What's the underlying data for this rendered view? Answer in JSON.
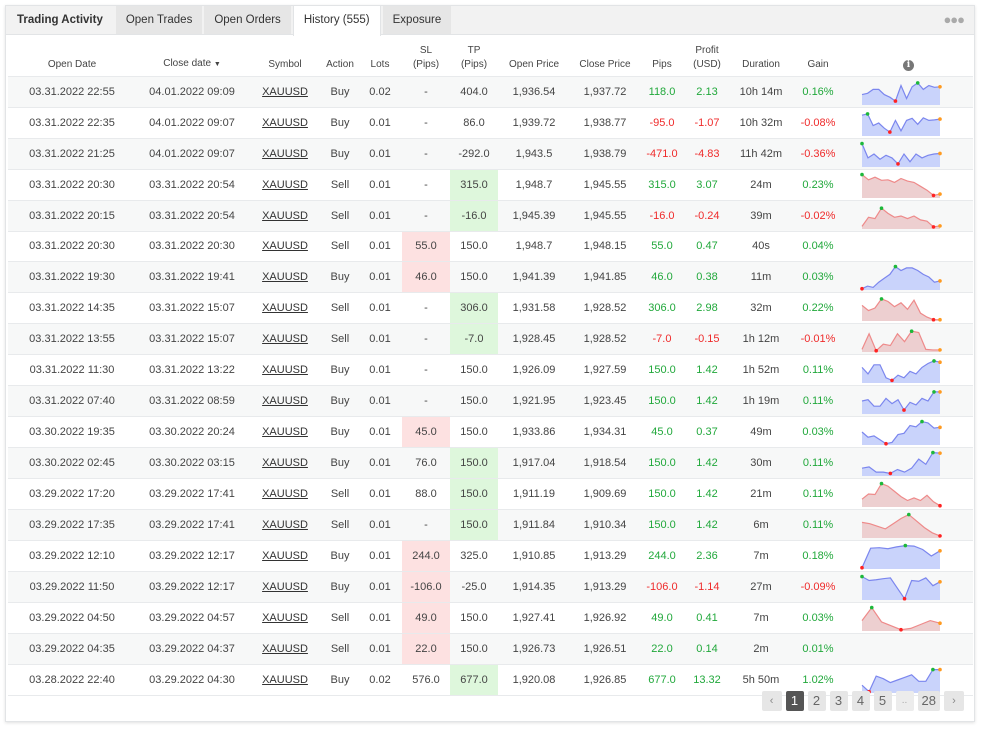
{
  "tabs": [
    {
      "label": "Trading Activity",
      "kind": "title"
    },
    {
      "label": "Open Trades"
    },
    {
      "label": "Open Orders"
    },
    {
      "label": "History (555)",
      "active": true
    },
    {
      "label": "Exposure"
    }
  ],
  "more_icon": "ellipsis-icon",
  "columns": {
    "open_date": "Open Date",
    "close_date": "Close date",
    "symbol": "Symbol",
    "action": "Action",
    "lots": "Lots",
    "sl_1": "SL",
    "sl_2": "(Pips)",
    "tp_1": "TP",
    "tp_2": "(Pips)",
    "open_price": "Open Price",
    "close_price": "Close Price",
    "pips": "Pips",
    "profit_1": "Profit",
    "profit_2": "(USD)",
    "duration": "Duration",
    "gain": "Gain",
    "info": "i"
  },
  "colors": {
    "positive": "#21a83b",
    "negative": "#ef2b2b",
    "buy_chart": "#7b86ee",
    "sell_chart": "#ee8a8a",
    "sl_highlight": "#fde1e1",
    "tp_highlight": "#def7dc"
  },
  "rows": [
    {
      "open": "03.31.2022 22:55",
      "close": "04.01.2022 09:09",
      "symbol": "XAUUSD",
      "action": "Buy",
      "lots": "0.02",
      "sl": "-",
      "tp": "404.0",
      "op": "1,936.54",
      "cp": "1,937.72",
      "pips": "118.0",
      "profit": "2.13",
      "duration": "10h 14m",
      "gain": "0.16%",
      "sign": "pos",
      "sl_hl": false,
      "tp_hl": false,
      "spark": [
        40,
        45,
        60,
        60,
        40,
        30,
        15,
        75,
        25,
        70,
        85,
        60,
        75,
        68,
        70
      ]
    },
    {
      "open": "03.31.2022 22:35",
      "close": "04.01.2022 09:07",
      "symbol": "XAUUSD",
      "action": "Buy",
      "lots": "0.01",
      "sl": "-",
      "tp": "86.0",
      "op": "1,939.72",
      "cp": "1,938.77",
      "pips": "-95.0",
      "profit": "-1.07",
      "duration": "10h 32m",
      "gain": "-0.08%",
      "sign": "neg",
      "sl_hl": false,
      "tp_hl": false,
      "spark": [
        80,
        85,
        40,
        50,
        30,
        15,
        60,
        20,
        60,
        68,
        45,
        70,
        60,
        62,
        65
      ]
    },
    {
      "open": "03.31.2022 21:25",
      "close": "04.01.2022 09:07",
      "symbol": "XAUUSD",
      "action": "Buy",
      "lots": "0.01",
      "sl": "-",
      "tp": "-292.0",
      "op": "1,943.5",
      "cp": "1,938.79",
      "pips": "-471.0",
      "profit": "-4.83",
      "duration": "11h 42m",
      "gain": "-0.36%",
      "sign": "neg",
      "sl_hl": false,
      "tp_hl": false,
      "spark": [
        90,
        35,
        50,
        30,
        45,
        35,
        12,
        50,
        20,
        50,
        35,
        45,
        50,
        52
      ]
    },
    {
      "open": "03.31.2022 20:30",
      "close": "03.31.2022 20:54",
      "symbol": "XAUUSD",
      "action": "Sell",
      "lots": "0.01",
      "sl": "-",
      "tp": "315.0",
      "op": "1,948.7",
      "cp": "1,945.55",
      "pips": "315.0",
      "profit": "3.07",
      "duration": "24m",
      "gain": "0.23%",
      "sign": "pos",
      "sl_hl": false,
      "tp_hl": true,
      "spark": [
        90,
        70,
        80,
        68,
        70,
        60,
        75,
        65,
        60,
        45,
        30,
        10,
        15
      ]
    },
    {
      "open": "03.31.2022 20:15",
      "close": "03.31.2022 20:54",
      "symbol": "XAUUSD",
      "action": "Sell",
      "lots": "0.01",
      "sl": "-",
      "tp": "-16.0",
      "op": "1,945.39",
      "cp": "1,945.55",
      "pips": "-16.0",
      "profit": "-0.24",
      "duration": "39m",
      "gain": "-0.02%",
      "sign": "neg",
      "sl_hl": false,
      "tp_hl": true,
      "spark": [
        10,
        45,
        40,
        80,
        60,
        45,
        50,
        40,
        50,
        35,
        30,
        8,
        12
      ]
    },
    {
      "open": "03.31.2022 20:30",
      "close": "03.31.2022 20:30",
      "symbol": "XAUUSD",
      "action": "Sell",
      "lots": "0.01",
      "sl": "55.0",
      "tp": "150.0",
      "op": "1,948.7",
      "cp": "1,948.15",
      "pips": "55.0",
      "profit": "0.47",
      "duration": "40s",
      "gain": "0.04%",
      "sign": "pos",
      "sl_hl": true,
      "tp_hl": false,
      "spark": []
    },
    {
      "open": "03.31.2022 19:30",
      "close": "03.31.2022 19:41",
      "symbol": "XAUUSD",
      "action": "Buy",
      "lots": "0.01",
      "sl": "46.0",
      "tp": "150.0",
      "op": "1,941.39",
      "cp": "1,941.85",
      "pips": "46.0",
      "profit": "0.38",
      "duration": "11m",
      "gain": "0.03%",
      "sign": "pos",
      "sl_hl": true,
      "tp_hl": false,
      "spark": [
        5,
        15,
        10,
        30,
        45,
        60,
        90,
        75,
        85,
        85,
        75,
        60,
        50,
        30,
        35
      ]
    },
    {
      "open": "03.31.2022 14:35",
      "close": "03.31.2022 15:07",
      "symbol": "XAUUSD",
      "action": "Sell",
      "lots": "0.01",
      "sl": "-",
      "tp": "306.0",
      "op": "1,931.58",
      "cp": "1,928.52",
      "pips": "306.0",
      "profit": "2.98",
      "duration": "32m",
      "gain": "0.22%",
      "sign": "pos",
      "sl_hl": false,
      "tp_hl": true,
      "spark": [
        60,
        40,
        50,
        85,
        75,
        55,
        70,
        45,
        80,
        30,
        15,
        5,
        5
      ]
    },
    {
      "open": "03.31.2022 13:55",
      "close": "03.31.2022 15:07",
      "symbol": "XAUUSD",
      "action": "Sell",
      "lots": "0.01",
      "sl": "-",
      "tp": "-7.0",
      "op": "1,928.45",
      "cp": "1,928.52",
      "pips": "-7.0",
      "profit": "-0.15",
      "duration": "1h 12m",
      "gain": "-0.01%",
      "sign": "neg",
      "sl_hl": false,
      "tp_hl": true,
      "spark": [
        10,
        70,
        5,
        30,
        25,
        70,
        40,
        80,
        75,
        10,
        8,
        8
      ]
    },
    {
      "open": "03.31.2022 11:30",
      "close": "03.31.2022 13:22",
      "symbol": "XAUUSD",
      "action": "Buy",
      "lots": "0.01",
      "sl": "-",
      "tp": "150.0",
      "op": "1,926.09",
      "cp": "1,927.59",
      "pips": "150.0",
      "profit": "1.42",
      "duration": "1h 52m",
      "gain": "0.11%",
      "sign": "pos",
      "sl_hl": false,
      "tp_hl": false,
      "spark": [
        60,
        35,
        70,
        70,
        20,
        10,
        30,
        20,
        45,
        35,
        60,
        75,
        85,
        80
      ]
    },
    {
      "open": "03.31.2022 07:40",
      "close": "03.31.2022 08:59",
      "symbol": "XAUUSD",
      "action": "Buy",
      "lots": "0.01",
      "sl": "-",
      "tp": "150.0",
      "op": "1,921.95",
      "cp": "1,923.45",
      "pips": "150.0",
      "profit": "1.42",
      "duration": "1h 19m",
      "gain": "0.11%",
      "sign": "pos",
      "sl_hl": false,
      "tp_hl": false,
      "spark": [
        50,
        55,
        30,
        30,
        60,
        40,
        55,
        15,
        45,
        35,
        60,
        50,
        85,
        85
      ]
    },
    {
      "open": "03.30.2022 19:35",
      "close": "03.30.2022 20:24",
      "symbol": "XAUUSD",
      "action": "Buy",
      "lots": "0.01",
      "sl": "45.0",
      "tp": "150.0",
      "op": "1,933.86",
      "cp": "1,934.31",
      "pips": "45.0",
      "profit": "0.37",
      "duration": "49m",
      "gain": "0.03%",
      "sign": "pos",
      "sl_hl": true,
      "tp_hl": false,
      "spark": [
        50,
        30,
        35,
        20,
        5,
        10,
        40,
        45,
        75,
        70,
        90,
        85,
        65,
        68
      ]
    },
    {
      "open": "03.30.2022 02:45",
      "close": "03.30.2022 03:15",
      "symbol": "XAUUSD",
      "action": "Buy",
      "lots": "0.01",
      "sl": "76.0",
      "tp": "150.0",
      "op": "1,917.04",
      "cp": "1,918.54",
      "pips": "150.0",
      "profit": "1.42",
      "duration": "30m",
      "gain": "0.11%",
      "sign": "pos",
      "sl_hl": false,
      "tp_hl": true,
      "spark": [
        30,
        35,
        15,
        15,
        10,
        25,
        15,
        30,
        65,
        45,
        90,
        88
      ]
    },
    {
      "open": "03.29.2022 17:20",
      "close": "03.29.2022 17:41",
      "symbol": "XAUUSD",
      "action": "Sell",
      "lots": "0.01",
      "sl": "88.0",
      "tp": "150.0",
      "op": "1,911.19",
      "cp": "1,909.69",
      "pips": "150.0",
      "profit": "1.42",
      "duration": "21m",
      "gain": "0.11%",
      "sign": "pos",
      "sl_hl": false,
      "tp_hl": true,
      "spark": [
        30,
        50,
        48,
        90,
        80,
        60,
        40,
        25,
        35,
        25,
        45,
        20,
        5
      ]
    },
    {
      "open": "03.29.2022 17:35",
      "close": "03.29.2022 17:41",
      "symbol": "XAUUSD",
      "action": "Sell",
      "lots": "0.01",
      "sl": "-",
      "tp": "150.0",
      "op": "1,911.84",
      "cp": "1,910.34",
      "pips": "150.0",
      "profit": "1.42",
      "duration": "6m",
      "gain": "0.11%",
      "sign": "pos",
      "sl_hl": false,
      "tp_hl": true,
      "spark": [
        60,
        55,
        45,
        35,
        55,
        75,
        90,
        65,
        40,
        20,
        8
      ]
    },
    {
      "open": "03.29.2022 12:10",
      "close": "03.29.2022 12:17",
      "symbol": "XAUUSD",
      "action": "Buy",
      "lots": "0.01",
      "sl": "244.0",
      "tp": "325.0",
      "op": "1,910.85",
      "cp": "1,913.29",
      "pips": "244.0",
      "profit": "2.36",
      "duration": "7m",
      "gain": "0.18%",
      "sign": "pos",
      "sl_hl": true,
      "tp_hl": false,
      "spark": [
        5,
        80,
        82,
        78,
        85,
        90,
        88,
        75,
        50,
        70
      ]
    },
    {
      "open": "03.29.2022 11:50",
      "close": "03.29.2022 12:17",
      "symbol": "XAUUSD",
      "action": "Buy",
      "lots": "0.01",
      "sl": "-106.0",
      "tp": "-25.0",
      "op": "1,914.35",
      "cp": "1,913.29",
      "pips": "-106.0",
      "profit": "-1.14",
      "duration": "27m",
      "gain": "-0.09%",
      "sign": "neg",
      "sl_hl": true,
      "tp_hl": false,
      "spark": [
        90,
        75,
        78,
        82,
        85,
        45,
        5,
        75,
        72,
        85,
        55,
        70
      ]
    },
    {
      "open": "03.29.2022 04:50",
      "close": "03.29.2022 04:57",
      "symbol": "XAUUSD",
      "action": "Sell",
      "lots": "0.01",
      "sl": "49.0",
      "tp": "150.0",
      "op": "1,927.41",
      "cp": "1,926.92",
      "pips": "49.0",
      "profit": "0.41",
      "duration": "7m",
      "gain": "0.03%",
      "sign": "pos",
      "sl_hl": true,
      "tp_hl": false,
      "spark": [
        40,
        90,
        35,
        20,
        5,
        10,
        25,
        40,
        30
      ]
    },
    {
      "open": "03.29.2022 04:35",
      "close": "03.29.2022 04:37",
      "symbol": "XAUUSD",
      "action": "Sell",
      "lots": "0.01",
      "sl": "22.0",
      "tp": "150.0",
      "op": "1,926.73",
      "cp": "1,926.51",
      "pips": "22.0",
      "profit": "0.14",
      "duration": "2m",
      "gain": "0.01%",
      "sign": "pos",
      "sl_hl": true,
      "tp_hl": false,
      "spark": []
    },
    {
      "open": "03.28.2022 22:40",
      "close": "03.29.2022 04:30",
      "symbol": "XAUUSD",
      "action": "Buy",
      "lots": "0.02",
      "sl": "576.0",
      "tp": "677.0",
      "op": "1,920.08",
      "cp": "1,926.85",
      "pips": "677.0",
      "profit": "13.32",
      "duration": "5h 50m",
      "gain": "1.02%",
      "sign": "pos",
      "sl_hl": false,
      "tp_hl": true,
      "spark": [
        30,
        5,
        65,
        55,
        40,
        50,
        60,
        70,
        45,
        45,
        90,
        90
      ]
    }
  ],
  "pagination": {
    "prev": "‹",
    "pages": [
      "1",
      "2",
      "3",
      "4",
      "5"
    ],
    "ellipsis": "..",
    "last": "28",
    "next": "›",
    "current": "1"
  }
}
